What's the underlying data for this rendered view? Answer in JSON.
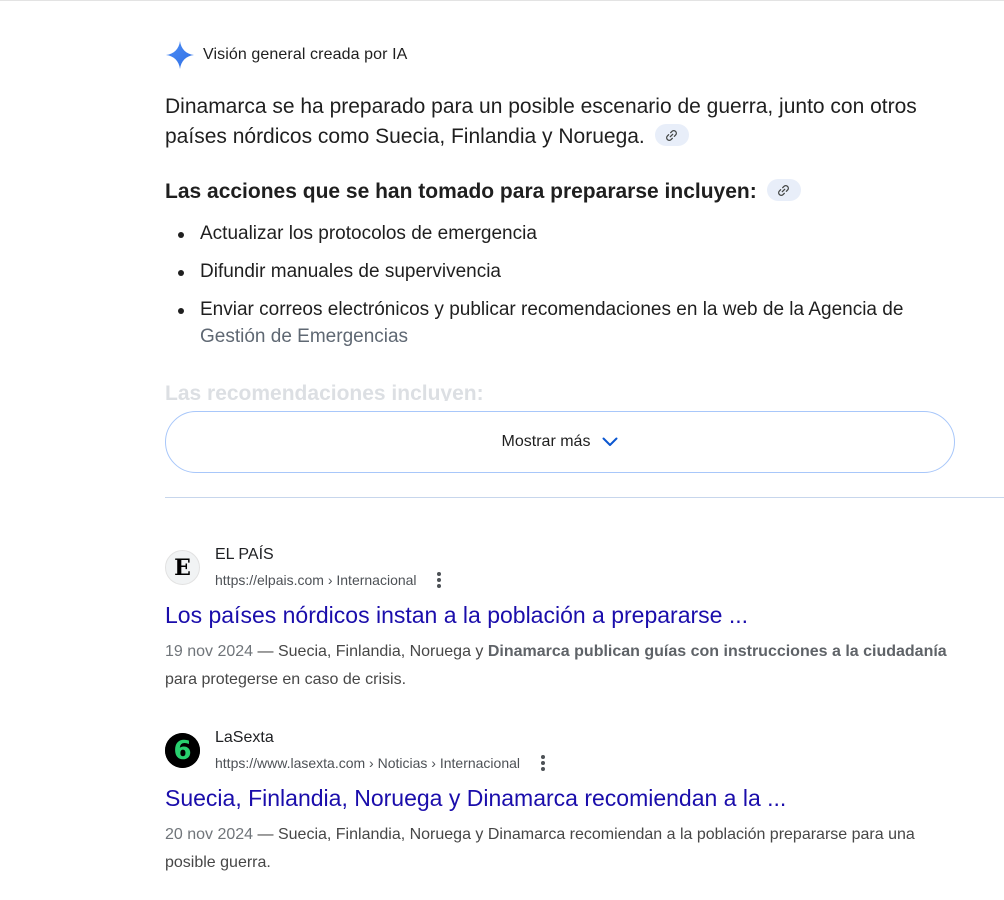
{
  "ai_overview": {
    "header_label": "Visión general creada por IA",
    "intro": "Dinamarca se ha preparado para un posible escenario de guerra, junto con otros países nórdicos como Suecia, Finlandia y Noruega.",
    "subheading": "Las acciones que se han tomado para prepararse incluyen:",
    "items": [
      "Actualizar los protocolos de emergencia",
      "Difundir manuales de supervivencia",
      "Enviar correos electrónicos y publicar recomendaciones en la web de la Agencia de"
    ],
    "item3_continuation": "Gestión de Emergencias",
    "faded_heading": "Las recomendaciones incluyen:",
    "show_more_label": "Mostrar más"
  },
  "results": [
    {
      "favicon_letter": "E",
      "source_name": "EL PAÍS",
      "url": "https://elpais.com › Internacional",
      "title": "Los países nórdicos instan a la población a prepararse ...",
      "date": "19 nov 2024",
      "snippet_part1": " — Suecia, Finlandia, Noruega y ",
      "snippet_bold": "Dinamarca publican guías con instrucciones a la ciudadanía",
      "snippet_part2": " para protegerse en caso de crisis."
    },
    {
      "favicon_letter": "6",
      "source_name": "LaSexta",
      "url": "https://www.lasexta.com › Noticias › Internacional",
      "title": "Suecia, Finlandia, Noruega y Dinamarca recomiendan a la ...",
      "date": "20 nov 2024",
      "snippet_part1": " — Suecia, Finlandia, Noruega y Dinamarca recomiendan a la población prepararse para una posible guerra."
    }
  ],
  "colors": {
    "link_title": "#1a0dab",
    "ai_spark_blue": "#4285f4",
    "button_border": "#a8c7fa",
    "lasexta_green": "#29d16f"
  },
  "icons": {
    "ai": "gemini-spark-icon",
    "cite": "link-icon",
    "expand": "chevron-down-icon",
    "menu": "more-vert-icon"
  }
}
